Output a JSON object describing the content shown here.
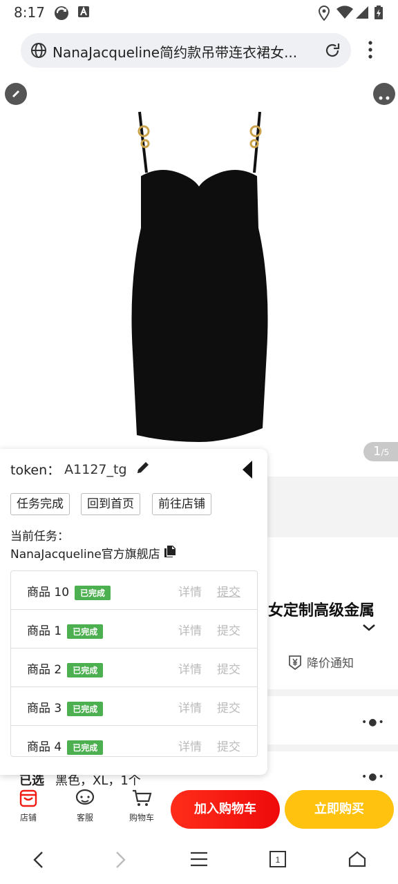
{
  "status_bar": {
    "time": "8:17"
  },
  "browser": {
    "url_title": "NanaJacqueline简约款吊带连衣裙女..."
  },
  "gallery": {
    "current": "1",
    "total": "/5"
  },
  "product": {
    "title_fragment": "女定制高级金属",
    "price_notice": "降价通知",
    "selected_label": "已选",
    "selected_value": "黑色，XL，1个",
    "dress_color": "#0e0e0e"
  },
  "action_bar": {
    "shop": "店铺",
    "service": "客服",
    "cart": "购物车",
    "add_to_cart": "加入购物车",
    "buy_now": "立即购买"
  },
  "panel": {
    "token_label": "token：",
    "token_value": "A1127_tg",
    "buttons": [
      "任务完成",
      "回到首页",
      "前往店铺"
    ],
    "current_task_label": "当前任务：",
    "current_task_value": "NanaJacqueline官方旗舰店",
    "items": [
      {
        "name": "商品 10",
        "status": "已完成",
        "detail": "详情",
        "submit": "提交"
      },
      {
        "name": "商品 1",
        "status": "已完成",
        "detail": "详情",
        "submit": "提交"
      },
      {
        "name": "商品 2",
        "status": "已完成",
        "detail": "详情",
        "submit": "提交"
      },
      {
        "name": "商品 3",
        "status": "已完成",
        "detail": "详情",
        "submit": "提交"
      },
      {
        "name": "商品 4",
        "status": "已完成",
        "detail": "详情",
        "submit": "提交"
      }
    ]
  },
  "colors": {
    "cart_red": "#f01a10",
    "buy_yellow": "#ffc20e",
    "badge_green": "#4caf50"
  }
}
